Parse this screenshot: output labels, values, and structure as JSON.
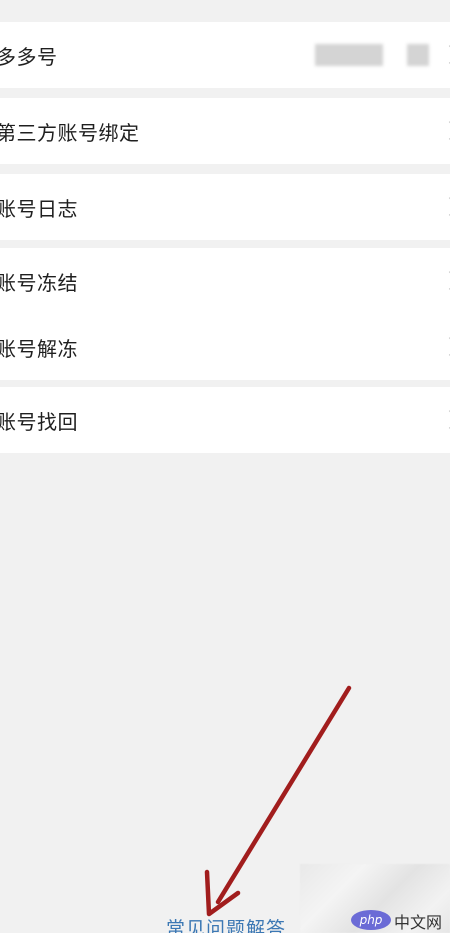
{
  "settings": {
    "rows": {
      "duoduo_id": "多多号",
      "third_party_binding": "第三方账号绑定",
      "account_log": "账号日志",
      "account_freeze": "账号冻结",
      "account_unfreeze": "账号解冻",
      "account_recover": "账号找回"
    }
  },
  "footer": {
    "faq_link": "常见问题解答"
  },
  "watermark": {
    "badge": "php",
    "site": "中文网"
  },
  "colors": {
    "background": "#f1f1f1",
    "card": "#ffffff",
    "link": "#3c78b4",
    "arrow": "#a11d1d"
  }
}
